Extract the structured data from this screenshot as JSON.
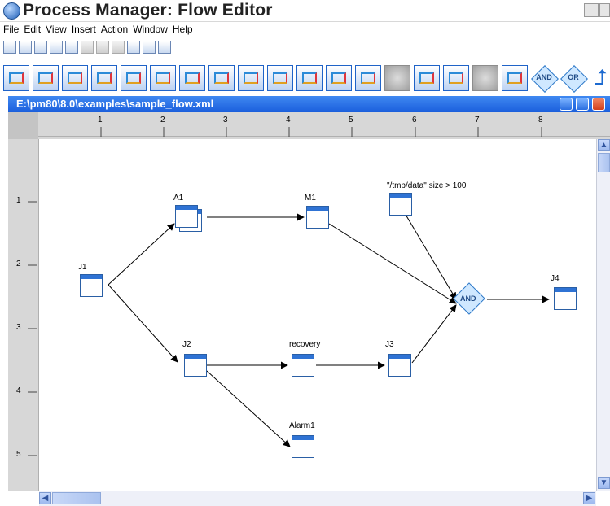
{
  "window": {
    "title": "Process Manager: Flow Editor"
  },
  "menu": [
    "File",
    "Edit",
    "View",
    "Insert",
    "Action",
    "Window",
    "Help"
  ],
  "document": {
    "path": "E:\\pm80\\8.0\\examples\\sample_flow.xml"
  },
  "ruler": {
    "horizontal": [
      "1",
      "2",
      "3",
      "4",
      "5",
      "6",
      "7",
      "8"
    ],
    "vertical": [
      "1",
      "2",
      "3",
      "4",
      "5"
    ]
  },
  "toolbar_big": {
    "and_label": "AND",
    "or_label": "OR"
  },
  "nodes": {
    "j1": "J1",
    "a1": "A1",
    "m1": "M1",
    "data": "\"/tmp/data\"  size > 100",
    "and_node": "AND",
    "j4": "J4",
    "j2": "J2",
    "recovery": "recovery",
    "j3": "J3",
    "alarm1": "Alarm1"
  },
  "colors": {
    "title_blue": "#1b5fdc",
    "node_border": "#2a5fa5",
    "and_fill": "#cfe8ff"
  }
}
